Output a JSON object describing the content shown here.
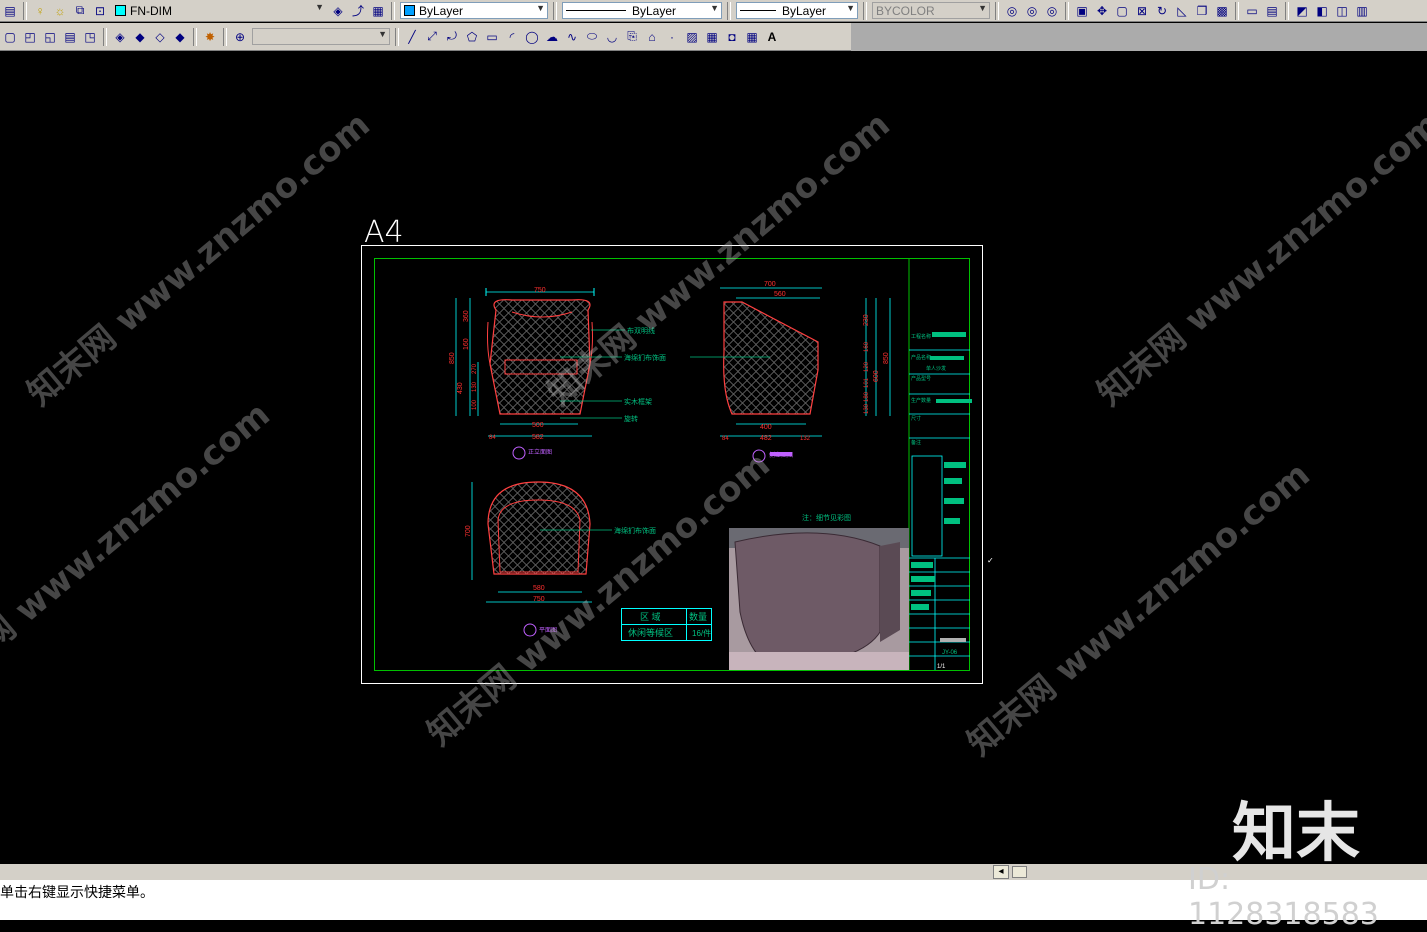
{
  "toolbar1": {
    "layer_name": "FN-DIM",
    "color": "ByLayer",
    "linetype": "ByLayer",
    "lineweight": "ByLayer",
    "plotstyle": "BYCOLOR"
  },
  "drawing": {
    "sheet_label": "A4",
    "dims": {
      "front_top": "750",
      "front_h_top": "360",
      "front_h_mid": "160",
      "front_h_total": "850",
      "front_h_seat": "430",
      "front_h_a": "270",
      "front_h_b": "130",
      "front_h_c": "100",
      "front_inner": "500",
      "front_bottom": "582",
      "front_side": "84",
      "side_top": "700",
      "side_top2": "560",
      "side_h1": "230",
      "side_h2": "160",
      "side_h3": "120",
      "side_h4": "101",
      "side_h5": "180",
      "side_h6": "130",
      "side_total": "850",
      "side_total2": "600",
      "side_inner": "400",
      "side_bottom": "482",
      "side_l": "84",
      "side_r": "132",
      "plan_h": "700",
      "plan_inner": "580",
      "plan_w": "750"
    },
    "notes": {
      "n1": "布双明线",
      "n2": "海绵扪布饰面",
      "n3": "实木框架",
      "n4": "旋转",
      "n5": "海绵扪布饰面",
      "photo_caption": "注：细节见彩图"
    },
    "views": {
      "front": "正立面图",
      "side": "侧立面图",
      "plan": "平面图"
    },
    "qty_table": {
      "h1": "区  域",
      "h2": "数量",
      "r1": "休闲等候区",
      "r2": "16/件"
    },
    "title_block": {
      "project": "工程名称",
      "product": "产品名称",
      "product_val": "单人沙发",
      "model": "产品型号",
      "qty": "生产数量",
      "size": "尺寸",
      "material": "备注",
      "code": "JY-06",
      "page": "1/1"
    }
  },
  "watermark": "知末网 www.znzmo.com",
  "logo_text": "知末",
  "image_id": "ID: 1128318583",
  "command_line": "单击右键显示快捷菜单。",
  "colors": {
    "cyan": "#00ffff",
    "red": "#ff2a2a",
    "green": "#00c000",
    "teal": "#00c080"
  }
}
